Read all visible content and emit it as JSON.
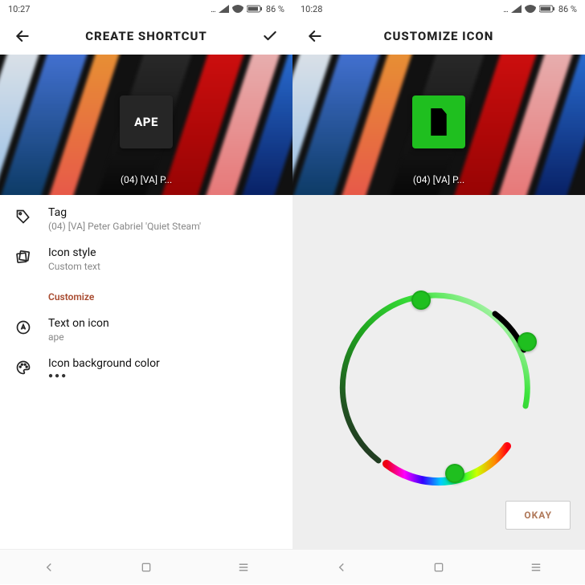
{
  "left": {
    "statusbar": {
      "time": "10:27",
      "battery": "86 %"
    },
    "appbar": {
      "title": "Create shortcut"
    },
    "hero": {
      "tile_text": "APE",
      "caption": "(04) [VA] P..."
    },
    "rows": {
      "tag": {
        "label": "Tag",
        "value": "(04) [VA] Peter Gabriel 'Quiet Steam'"
      },
      "iconstyle": {
        "label": "Icon style",
        "value": "Custom text"
      },
      "customize": {
        "label": "Customize"
      },
      "texticon": {
        "label": "Text on icon",
        "value": "ape"
      },
      "bgcolor": {
        "label": "Icon background color",
        "value": "●●●"
      }
    }
  },
  "right": {
    "statusbar": {
      "time": "10:28",
      "battery": "86 %"
    },
    "appbar": {
      "title": "Customize icon"
    },
    "hero": {
      "caption": "(04) [VA] P..."
    },
    "ok": "OKAY",
    "color": "#1fbf1f"
  }
}
